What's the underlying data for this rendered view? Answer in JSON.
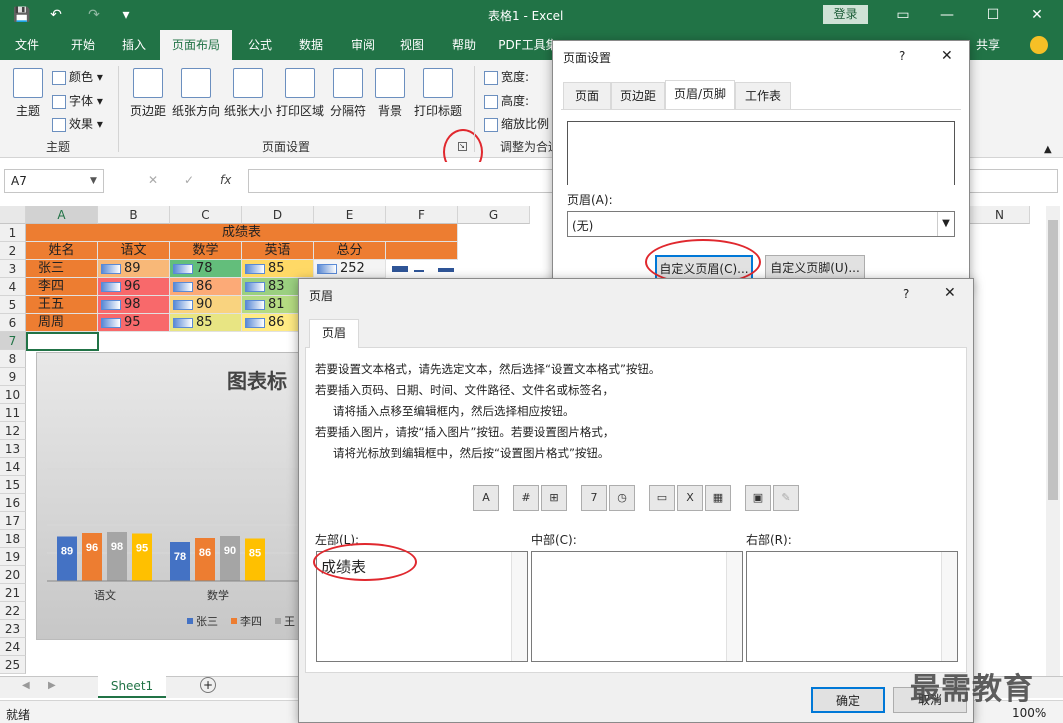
{
  "titlebar": {
    "title": "表格1 - Excel",
    "login": "登录",
    "undo": "↶",
    "redo": "↷",
    "quick": "▾",
    "save": "💾"
  },
  "tabs": [
    "文件",
    "开始",
    "插入",
    "页面布局",
    "公式",
    "数据",
    "审阅",
    "视图",
    "帮助",
    "PDF工具集"
  ],
  "share": "共享",
  "ribbon": {
    "theme": {
      "label": "主题",
      "colors": "颜色",
      "fonts": "字体",
      "effects": "效果",
      "group": "主题"
    },
    "pagesetup": {
      "margins": "页边距",
      "orientation": "纸张方向",
      "size": "纸张大小",
      "print_area": "打印区域",
      "breaks": "分隔符",
      "background": "背景",
      "print_titles": "打印标题",
      "group": "页面设置"
    },
    "scale": {
      "width": "宽度:",
      "height": "高度:",
      "scale": "缩放比例",
      "group": "调整为合适"
    }
  },
  "formula": {
    "namebox": "A7",
    "cancel": "✕",
    "enter": "✓",
    "fx": "fx"
  },
  "columns": [
    "A",
    "B",
    "C",
    "D",
    "E",
    "F",
    "G",
    "N"
  ],
  "rows": [
    "1",
    "2",
    "3",
    "4",
    "5",
    "6",
    "7",
    "8",
    "9",
    "10",
    "11",
    "12",
    "13",
    "14",
    "15",
    "16",
    "17",
    "18",
    "19",
    "20",
    "21",
    "22",
    "23",
    "24",
    "25"
  ],
  "table": {
    "title": "成绩表",
    "headers": [
      "姓名",
      "语文",
      "数学",
      "英语",
      "总分"
    ],
    "rows": [
      {
        "name": "张三",
        "chinese": "89",
        "math": "78",
        "english": "85",
        "total": "252"
      },
      {
        "name": "李四",
        "chinese": "96",
        "math": "86",
        "english": "83"
      },
      {
        "name": "王五",
        "chinese": "98",
        "math": "90",
        "english": "81"
      },
      {
        "name": "周周",
        "chinese": "95",
        "math": "85",
        "english": "86"
      }
    ]
  },
  "chart_data": {
    "type": "bar",
    "title": "图表标",
    "categories": [
      "语文",
      "数学"
    ],
    "series": [
      {
        "name": "张三",
        "color": "#4472c4",
        "values": [
          89,
          78
        ]
      },
      {
        "name": "李四",
        "color": "#ed7d31",
        "values": [
          96,
          86
        ]
      },
      {
        "name": "王",
        "color": "#a5a5a5",
        "values": [
          98,
          90
        ]
      },
      {
        "color": "#ffc000",
        "values": [
          95,
          85
        ]
      }
    ],
    "legend_position": "bottom"
  },
  "sheet": {
    "tab": "Sheet1",
    "add": "+"
  },
  "status": {
    "ready": "就绪",
    "zoom": "100%"
  },
  "pagesetup_dialog": {
    "title": "页面设置",
    "help": "?",
    "close": "✕",
    "tabs": [
      "页面",
      "页边距",
      "页眉/页脚",
      "工作表"
    ],
    "header_label": "页眉(A):",
    "header_value": "(无)",
    "custom_header": "自定义页眉(C)...",
    "custom_footer": "自定义页脚(U)..."
  },
  "header_dialog": {
    "title": "页眉",
    "help": "?",
    "close": "✕",
    "tab": "页眉",
    "instructions": [
      "若要设置文本格式，请先选定文本，然后选择“设置文本格式”按钮。",
      "若要插入页码、日期、时间、文件路径、文件名或标签名，",
      "请将插入点移至编辑框内，然后选择相应按钮。",
      "若要插入图片，请按“插入图片”按钮。若要设置图片格式，",
      "请将光标放到编辑框中，然后按“设置图片格式”按钮。"
    ],
    "icon_labels": [
      "A",
      "#",
      "⊞",
      "7",
      "◷",
      "▭",
      "X",
      "▦",
      "▣",
      "✎"
    ],
    "left_label": "左部(L):",
    "center_label": "中部(C):",
    "right_label": "右部(R):",
    "left_value": "成绩表",
    "center_value": "",
    "right_value": "",
    "ok": "确定",
    "cancel": "取消"
  },
  "watermark": "最需教育"
}
